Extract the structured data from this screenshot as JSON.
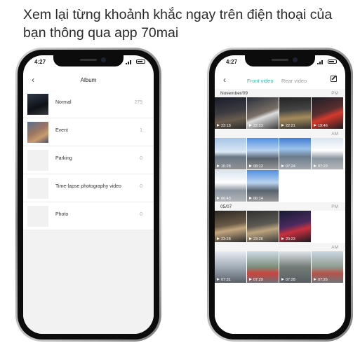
{
  "headline": "Xem lại từng khoảnh khắc ngay trên điện thoại của bạn thông qua app 70mai",
  "left_phone": {
    "status_time": "4:27",
    "title": "Album",
    "items": [
      {
        "label": "Normal",
        "count": "275"
      },
      {
        "label": "Event",
        "count": "1"
      },
      {
        "label": "Parking",
        "count": "0"
      },
      {
        "label": "Time-lapse photography video",
        "count": "0"
      },
      {
        "label": "Photo",
        "count": "0"
      }
    ]
  },
  "right_phone": {
    "status_time": "4:27",
    "tabs": {
      "front": "Front video",
      "rear": "Rear video"
    },
    "sections": [
      {
        "date": "November/09",
        "period": "PM",
        "durations": [
          "23:18",
          "22:23",
          "22:21",
          "19:46"
        ]
      },
      {
        "date": "",
        "period": "AM",
        "durations": [
          "10:28",
          "08:12",
          "07:24",
          "07:23",
          "06:43",
          "06:14"
        ]
      },
      {
        "date": "05/07",
        "period": "PM",
        "durations": [
          "23:28",
          "23:20",
          "20:23"
        ]
      },
      {
        "date": "",
        "period": "AM",
        "durations": [
          "07:31",
          "07:29",
          "07:28",
          "07:26"
        ]
      }
    ]
  },
  "colors": {
    "accent": "#38b5a5"
  }
}
